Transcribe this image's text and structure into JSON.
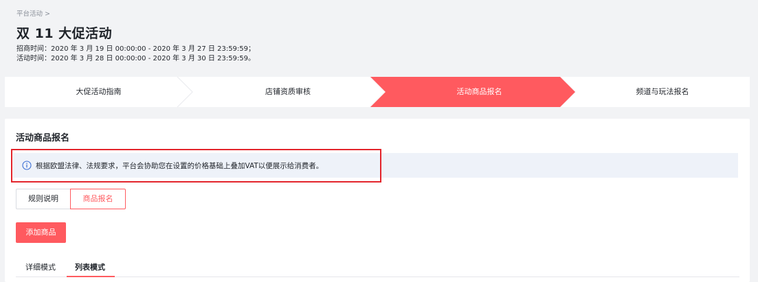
{
  "breadcrumb": {
    "parent": "平台活动",
    "separator": ">"
  },
  "page": {
    "title": "双 11 大促活动",
    "recruit_time": "招商时间：2020 年 3 月 19 日 00:00:00 - 2020 年 3 月 27 日 23:59:59；",
    "activity_time": "活动时间：2020 年 3 月 28 日 00:00:00 - 2020 年 3 月 30 日 23:59:59。"
  },
  "steps": [
    {
      "label": "大促活动指南",
      "active": false
    },
    {
      "label": "店铺资质审核",
      "active": false
    },
    {
      "label": "活动商品报名",
      "active": true
    },
    {
      "label": "频道与玩法报名",
      "active": false
    }
  ],
  "section": {
    "title": "活动商品报名",
    "notice": "根据欧盟法律、法规要求，平台会协助您在设置的价格基础上叠加VAT以便展示给消费者。"
  },
  "segments": {
    "rules": "规则说明",
    "goods": "商品报名",
    "selected": "商品报名"
  },
  "actions": {
    "add_goods": "添加商品"
  },
  "modes": {
    "detail": "详细模式",
    "list": "列表模式",
    "selected": "列表模式"
  },
  "colors": {
    "accent": "#ff5a5f",
    "highlight": "#e3242b",
    "notice_bg": "#eef2f9",
    "page_bg": "#f2f3f5"
  },
  "icons": {
    "notice": "info-circle-icon"
  }
}
